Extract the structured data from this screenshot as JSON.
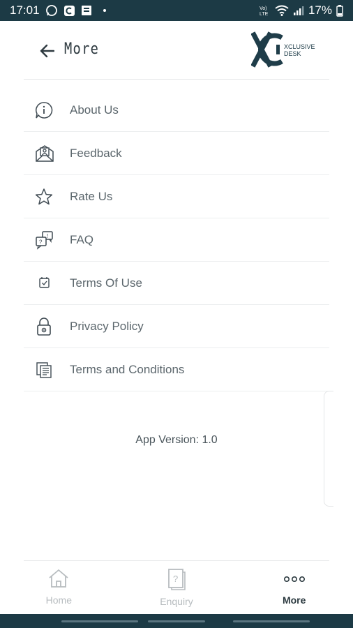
{
  "status_bar": {
    "time": "17:01",
    "battery": "17%",
    "icons": [
      "whatsapp-icon",
      "app-notification-icon",
      "message-icon",
      "volte-icon",
      "wifi-icon",
      "signal-icon",
      "battery-icon"
    ]
  },
  "header": {
    "title": "More",
    "logo_text": "XCLUSIVE DESK",
    "back_icon": "arrow-left-icon"
  },
  "menu": {
    "items": [
      {
        "label": "About Us",
        "icon": "info-bubble-icon"
      },
      {
        "label": "Feedback",
        "icon": "envelope-person-icon"
      },
      {
        "label": "Rate Us",
        "icon": "star-icon"
      },
      {
        "label": "FAQ",
        "icon": "faq-bubbles-icon"
      },
      {
        "label": "Terms Of Use",
        "icon": "checkbox-icon"
      },
      {
        "label": "Privacy Policy",
        "icon": "lock-icon"
      },
      {
        "label": "Terms and Conditions",
        "icon": "documents-icon"
      }
    ]
  },
  "app_version": "App Version: 1.0",
  "bottom_nav": {
    "items": [
      {
        "label": "Home",
        "icon": "home-icon",
        "active": false
      },
      {
        "label": "Enquiry",
        "icon": "enquiry-document-icon",
        "active": false
      },
      {
        "label": "More",
        "icon": "more-dots-icon",
        "active": true
      }
    ]
  },
  "colors": {
    "status_bar": "#1c3a45",
    "brand": "#1f3d49",
    "text": "#5b666c",
    "inactive": "#b7bcbf"
  }
}
